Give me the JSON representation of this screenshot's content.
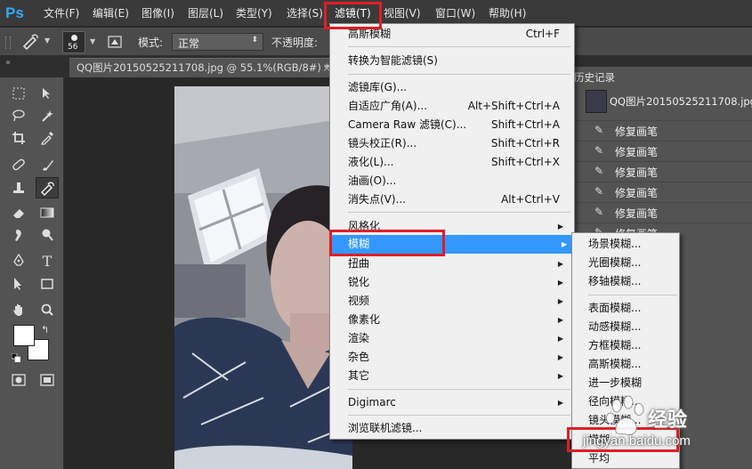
{
  "app": {
    "logo": "Ps"
  },
  "menubar": {
    "items": [
      "文件(F)",
      "编辑(E)",
      "图像(I)",
      "图层(L)",
      "类型(Y)",
      "选择(S)",
      "滤镜(T)",
      "视图(V)",
      "窗口(W)",
      "帮助(H)"
    ],
    "active_index": 6
  },
  "options_bar": {
    "brush_size": "56",
    "mode_label": "模式:",
    "mode_value": "正常",
    "opacity_label": "不透明度:"
  },
  "document": {
    "tab_title": "QQ图片20150525211708.jpg @ 55.1%(RGB/8#) *",
    "close_glyph": "×"
  },
  "history": {
    "tab_label": "历史记录",
    "snapshot_label": "QQ图片20150525211708.jpg",
    "items": [
      "修复画笔",
      "修复画笔",
      "修复画笔",
      "修复画笔",
      "修复画笔",
      "修复画笔"
    ]
  },
  "filter_menu": {
    "top": [
      {
        "label": "高斯模糊",
        "shortcut": "Ctrl+F"
      }
    ],
    "smart": [
      {
        "label": "转换为智能滤镜(S)",
        "shortcut": ""
      }
    ],
    "gallery": [
      {
        "label": "滤镜库(G)...",
        "shortcut": ""
      },
      {
        "label": "自适应广角(A)...",
        "shortcut": "Alt+Shift+Ctrl+A"
      },
      {
        "label": "Camera Raw 滤镜(C)...",
        "shortcut": "Shift+Ctrl+A"
      },
      {
        "label": "镜头校正(R)...",
        "shortcut": "Shift+Ctrl+R"
      },
      {
        "label": "液化(L)...",
        "shortcut": "Shift+Ctrl+X"
      },
      {
        "label": "油画(O)...",
        "shortcut": ""
      },
      {
        "label": "消失点(V)...",
        "shortcut": "Alt+Ctrl+V"
      }
    ],
    "categories": [
      "风格化",
      "模糊",
      "扭曲",
      "锐化",
      "视频",
      "像素化",
      "渲染",
      "杂色",
      "其它"
    ],
    "highlighted_category_index": 1,
    "digimarc": "Digimarc",
    "browse_online": "浏览联机滤镜...",
    "arrow_glyph": "▶"
  },
  "blur_submenu": {
    "group1": [
      "场景模糊...",
      "光圈模糊...",
      "移轴模糊..."
    ],
    "group2": [
      "表面模糊...",
      "动感模糊...",
      "方框模糊...",
      "高斯模糊...",
      "进一步模糊",
      "径向模糊...",
      "镜头模糊...",
      "模糊",
      "平均"
    ]
  },
  "watermark": {
    "text": "jingyan.baidu.com",
    "cn": "经验"
  },
  "colors": {
    "highlight": "#3399ff",
    "annotation_red": "#e01e25",
    "ps_blue": "#31a8ff"
  }
}
